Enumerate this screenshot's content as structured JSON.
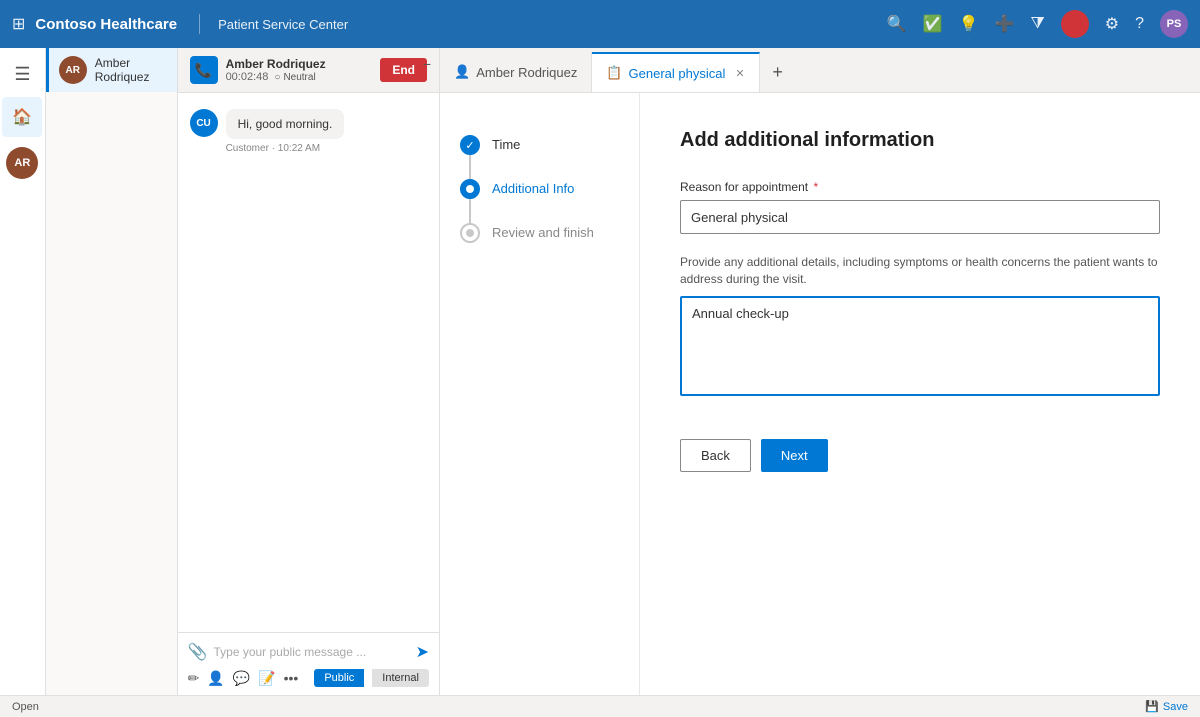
{
  "app": {
    "brand": "Contoso Healthcare",
    "service": "Patient Service Center"
  },
  "topnav": {
    "icons": [
      "search",
      "checkmark-circle",
      "lightbulb",
      "plus",
      "filter"
    ],
    "notification_bg": "#d13438",
    "avatar_label": "PS",
    "avatar_bg": "#8764b8"
  },
  "sidebar": {
    "home_label": "Home"
  },
  "user_list": {
    "users": [
      {
        "id": "AR",
        "name": "Amber Rodriquez",
        "active": true,
        "color": "#8e4b2e"
      }
    ]
  },
  "chat": {
    "caller_name": "Amber Rodriquez",
    "timer": "00:02:48",
    "sentiment": "Neutral",
    "end_button": "End",
    "messages": [
      {
        "avatar": "CU",
        "avatar_bg": "#0078d4",
        "text": "Hi, good morning.",
        "meta": "Customer · 10:22 AM"
      }
    ],
    "input_placeholder": "Type your public message ...",
    "tab_public": "Public",
    "tab_internal": "Internal"
  },
  "tabs": [
    {
      "id": "amber",
      "label": "Amber Rodriquez",
      "icon": "👤",
      "closable": false,
      "active": false
    },
    {
      "id": "general",
      "label": "General physical",
      "icon": "📋",
      "closable": true,
      "active": true
    }
  ],
  "tab_add_label": "+",
  "wizard": {
    "steps": [
      {
        "id": "time",
        "label": "Time",
        "state": "done"
      },
      {
        "id": "additional",
        "label": "Additional Info",
        "state": "active"
      },
      {
        "id": "review",
        "label": "Review and finish",
        "state": "pending"
      }
    ],
    "form": {
      "title": "Add additional information",
      "reason_label": "Reason for appointment",
      "reason_required": true,
      "reason_value": "General physical",
      "details_hint": "Provide any additional details, including symptoms or health concerns the patient wants to address during the visit.",
      "details_value": "Annual check-up",
      "back_label": "Back",
      "next_label": "Next"
    }
  },
  "status_bar": {
    "open_label": "Open",
    "save_label": "Save",
    "save_icon": "💾"
  }
}
